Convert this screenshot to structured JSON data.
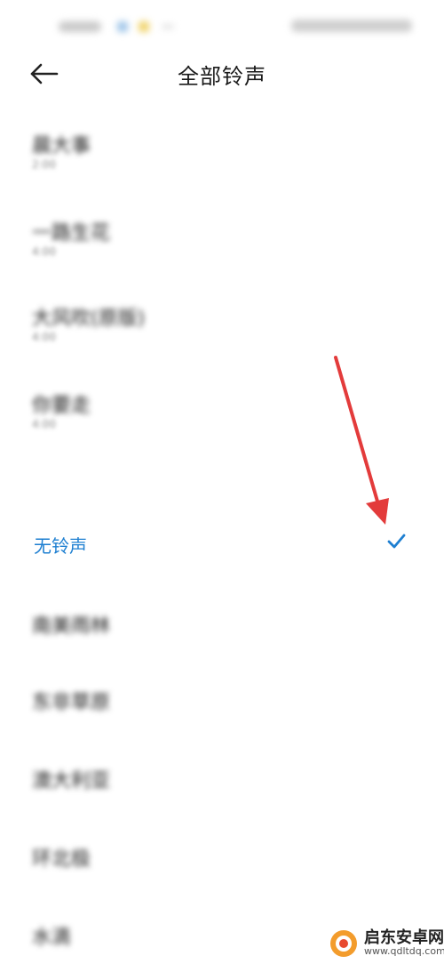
{
  "status_bar": {
    "time": "16:27",
    "right": "3.4K/s 5G 令 56"
  },
  "header": {
    "title": "全部铃声",
    "back_icon": "back-arrow-icon"
  },
  "ringtones": [
    {
      "title": "晨大事",
      "subtitle": "2:00"
    },
    {
      "title": "一路生花",
      "subtitle": "4:00"
    },
    {
      "title": "大风吹(原版)",
      "subtitle": "4:00"
    },
    {
      "title": "你要走",
      "subtitle": "4:00"
    }
  ],
  "no_ringtone": {
    "label": "无铃声",
    "selected": true,
    "check_icon": "checkmark-icon",
    "accent_color": "#1e7fd1"
  },
  "more_ringtones": [
    {
      "title": "南美雨林"
    },
    {
      "title": "东非草原"
    },
    {
      "title": "澳大利亚"
    },
    {
      "title": "环北极"
    },
    {
      "title": "水滴"
    }
  ],
  "annotation": {
    "arrow_color": "#e33b3b"
  },
  "watermark": {
    "name": "启东安卓网",
    "url": "www.qdltdq.com"
  }
}
